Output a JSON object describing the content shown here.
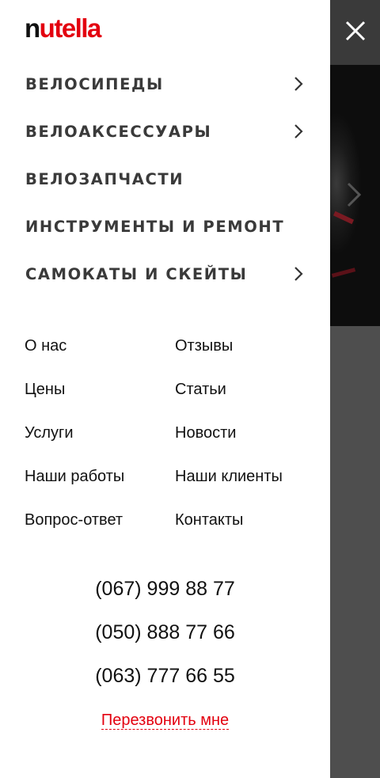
{
  "brand": {
    "logo_first": "n",
    "logo_rest": "utella",
    "accent_color": "#e3000f"
  },
  "close_icon": "close-icon",
  "categories": [
    {
      "label": "ВЕЛОСИПЕДЫ",
      "has_submenu": true
    },
    {
      "label": "ВЕЛОАКСЕССУАРЫ",
      "has_submenu": true
    },
    {
      "label": "ВЕЛОЗАПЧАСТИ",
      "has_submenu": false
    },
    {
      "label": "ИНСТРУМЕНТЫ И РЕМОНТ",
      "has_submenu": false
    },
    {
      "label": "САМОКАТЫ И СКЕЙТЫ",
      "has_submenu": true
    }
  ],
  "links": {
    "left": [
      "О нас",
      "Цены",
      "Услуги",
      "Наши работы",
      "Вопрос-ответ"
    ],
    "right": [
      "Отзывы",
      "Статьи",
      "Новости",
      "Наши клиенты",
      "Контакты"
    ]
  },
  "phones": [
    "(067) 999 88 77",
    "(050) 888 77 66",
    "(063) 777 66 55"
  ],
  "callback_label": "Перезвонить мне"
}
